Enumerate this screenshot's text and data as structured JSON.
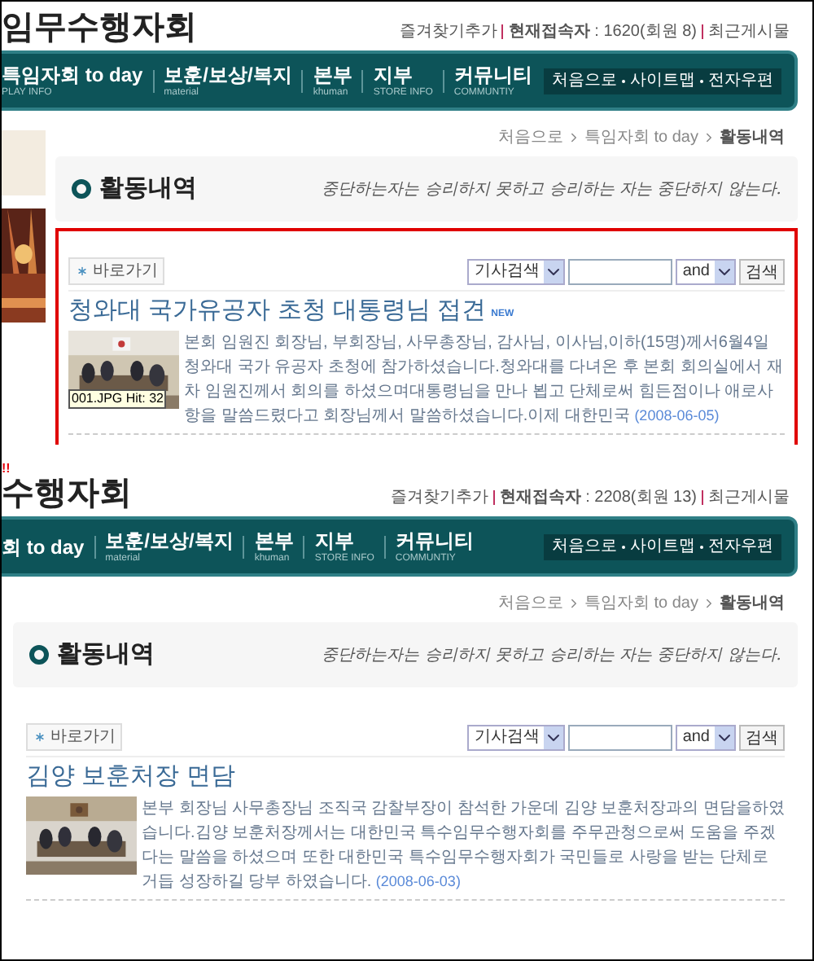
{
  "screens": [
    {
      "highlighted": true,
      "sidebar": {
        "kind": "picture"
      },
      "logo": "임무수행자회",
      "top_links": [
        "즐겨찾기추가",
        "**현재접속자** : 1620(회원 8)",
        "최근게시물"
      ],
      "nav": [
        {
          "title": "특임자회 to day",
          "subtitle": "PLAY INFO"
        },
        {
          "title": "보훈/보상/복지",
          "subtitle": "material"
        },
        {
          "title": "본부",
          "subtitle": "khuman"
        },
        {
          "title": "지부",
          "subtitle": "STORE INFO"
        },
        {
          "title": "커뮤니티",
          "subtitle": "COMMUNTIY"
        }
      ],
      "quick_links": [
        "처음으로",
        "사이트맵",
        "전자우편"
      ],
      "breadcrumb": [
        "처음으로",
        "특임자회 to day",
        "활동내역"
      ],
      "section_title": "활동내역",
      "motto": "중단하는자는 승리하지 못하고 승리하는 자는 중단하지 않는다.",
      "toolbar": {
        "shortcut": "바로가기",
        "search_type": "기사검색",
        "operator": "and",
        "search_button": "검색"
      },
      "articles": [
        {
          "title": "청와대 국가유공자 초청 대통령님 접견",
          "badge": "NEW",
          "text": "본회 임원진 회장님, 부회장님, 사무총장님, 감사님, 이사님,이하(15명)께서6월4일 청와대 국가 유공자 초청에 참가하셨습니다.청와대를 다녀온 후 본회 회의실에서 재차 임원진께서 회의를 하셨으며대통령님을 만나 뵙고  단체로써 힘든점이나 애로사항을 말씀드렸다고 회장님께서 말씀하셨습니다.이제 대한민국",
          "date": "(2008-06-05)",
          "tooltip": "001.JPG Hit: 32"
        }
      ]
    },
    {
      "highlighted": false,
      "alert_mark": "!!",
      "logo": "수행자회",
      "top_links": [
        "즐겨찾기추가",
        "**현재접속자** : 2208(회원 13)",
        "최근게시물"
      ],
      "nav": [
        {
          "title": "회 to day"
        },
        {
          "title": "보훈/보상/복지",
          "subtitle": "material"
        },
        {
          "title": "본부",
          "subtitle": "khuman"
        },
        {
          "title": "지부",
          "subtitle": "STORE INFO"
        },
        {
          "title": "커뮤니티",
          "subtitle": "COMMUNTIY"
        }
      ],
      "quick_links": [
        "처음으로",
        "사이트맵",
        "전자우편"
      ],
      "breadcrumb": [
        "처음으로",
        "특임자회 to day",
        "활동내역"
      ],
      "section_title": "활동내역",
      "motto": "중단하는자는 승리하지 못하고 승리하는 자는 중단하지 않는다.",
      "toolbar": {
        "shortcut": "바로가기",
        "search_type": "기사검색",
        "operator": "and",
        "search_button": "검색"
      },
      "articles": [
        {
          "title": "김양 보훈처장 면담",
          "text": "본부 회장님 사무총장님 조직국 감찰부장이 참석한 가운데 김양 보훈처장과의 면담을하였습니다.김양 보훈처장께서는  대한민국 특수임무수행자회를 주무관청으로써 도움을 주겠다는 말씀을 하셨으며 또한 대한민국 특수임무수행자회가 국민들로 사랑을 받는 단체로 거듭 성장하길 당부 하였습니다.",
          "date": "(2008-06-03)"
        }
      ]
    }
  ]
}
